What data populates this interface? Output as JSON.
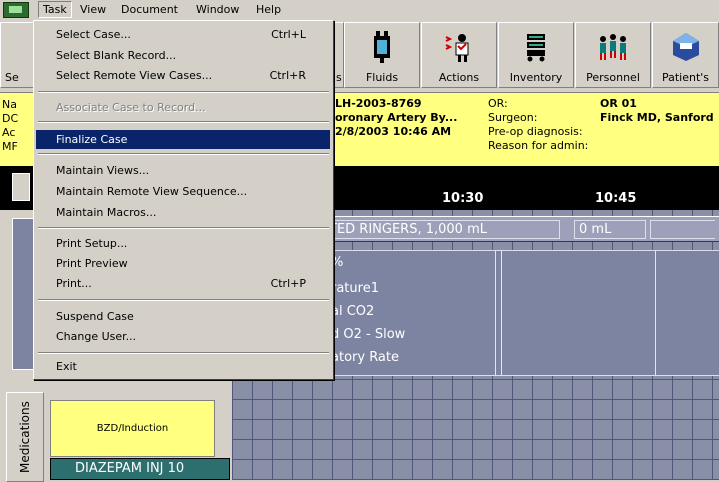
{
  "menubar": {
    "items": [
      "Task",
      "View",
      "Document",
      "Window",
      "Help"
    ]
  },
  "toolbar": {
    "left_partial": "Se",
    "partial_s": "s",
    "buttons": [
      "Fluids",
      "Actions",
      "Inventory",
      "Personnel",
      "Patient's"
    ]
  },
  "info": {
    "left_labels": [
      "Na",
      "DC",
      "Ac",
      "MF"
    ],
    "case_id": "LH-2003-8769",
    "procedure": "oronary Artery By...",
    "datetime": "2/8/2003 10:46 AM",
    "or_label": "OR:",
    "or_value": "OR 01",
    "surgeon_label": "Surgeon:",
    "surgeon_value": "Finck MD, Sanford",
    "preop_label": "Pre-op diagnosis:",
    "reason_label": "Reason for admin:"
  },
  "timeline": {
    "ticks": [
      "10:30",
      "10:45"
    ]
  },
  "fluids": {
    "name": "TED RINGERS, 1,000 mL",
    "amount": "0 mL"
  },
  "vitals": [
    "%",
    "rature1",
    "al CO2",
    "d O2 - Slow",
    "atory Rate"
  ],
  "left": {
    "tab": "Medications",
    "induction": "BZD/Induction",
    "drug": "DIAZEPAM INJ 10"
  },
  "menu": {
    "items": [
      {
        "label": "Select Case...",
        "shortcut": "Ctrl+L"
      },
      {
        "label": "Select Blank Record...",
        "shortcut": ""
      },
      {
        "label": "Select Remote View Cases...",
        "shortcut": "Ctrl+R"
      },
      {
        "label": "Associate Case to Record...",
        "shortcut": "",
        "disabled": true
      },
      {
        "label": "Finalize Case",
        "shortcut": "",
        "selected": true
      },
      {
        "label": "Maintain Views...",
        "shortcut": ""
      },
      {
        "label": "Maintain Remote View Sequence...",
        "shortcut": ""
      },
      {
        "label": "Maintain Macros...",
        "shortcut": ""
      },
      {
        "label": "Print Setup...",
        "shortcut": ""
      },
      {
        "label": "Print Preview",
        "shortcut": ""
      },
      {
        "label": "Print...",
        "shortcut": "Ctrl+P"
      },
      {
        "label": "Suspend Case",
        "shortcut": ""
      },
      {
        "label": "Change User...",
        "shortcut": ""
      },
      {
        "label": "Exit",
        "shortcut": ""
      }
    ]
  },
  "colors": {
    "menu_highlight": "#0a246a",
    "info_bg": "#ffff80",
    "grid_bg": "#8a8fa8"
  }
}
